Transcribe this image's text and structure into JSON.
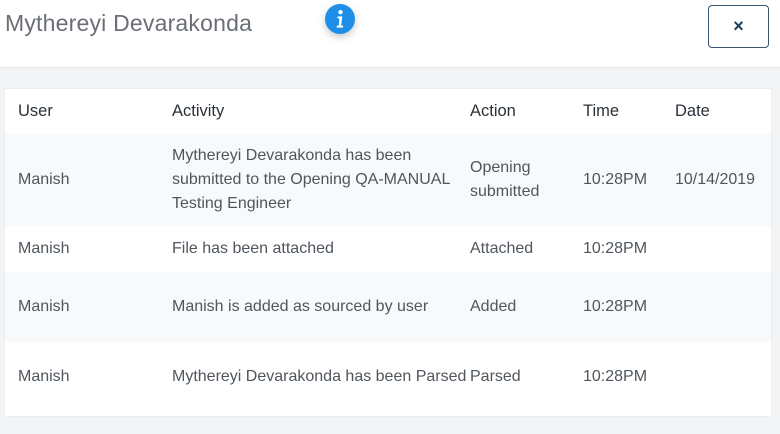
{
  "header": {
    "title": "Mythereyi Devarakonda",
    "info_icon": "info-icon",
    "close_label": "×"
  },
  "table": {
    "columns": [
      "User",
      "Activity",
      "Action",
      "Time",
      "Date"
    ],
    "rows": [
      {
        "user": "Manish",
        "activity": "Mythereyi Devarakonda has been submitted to the Opening QA-MANUAL Testing Engineer",
        "action": "Opening submitted",
        "time": "10:28PM",
        "date": "10/14/2019"
      },
      {
        "user": "Manish",
        "activity": "File has been attached",
        "action": "Attached",
        "time": "10:28PM",
        "date": ""
      },
      {
        "user": "Manish",
        "activity": "Manish is added as sourced by user",
        "action": "Added",
        "time": "10:28PM",
        "date": ""
      },
      {
        "user": "Manish",
        "activity": "Mythereyi Devarakonda has been Parsed",
        "action": "Parsed",
        "time": "10:28PM",
        "date": ""
      }
    ]
  },
  "colors": {
    "accent": "#1f8ee8",
    "close_border": "#3a5570",
    "title_text": "#6a6f76",
    "stripe": "#f8f9fa"
  }
}
